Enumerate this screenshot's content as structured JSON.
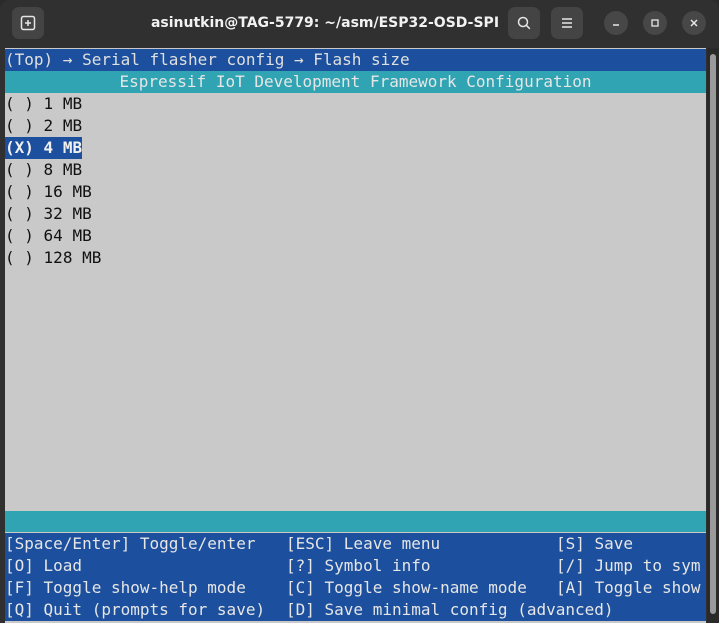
{
  "window": {
    "title": "asinutkin@TAG-5779: ~/asm/ESP32-OSD-SPI"
  },
  "menuconfig": {
    "breadcrumb": "(Top) → Serial flasher config → Flash size",
    "header": "Espressif IoT Development Framework Configuration",
    "options": [
      {
        "mark": "( )",
        "label": "1 MB"
      },
      {
        "mark": "( )",
        "label": "2 MB"
      },
      {
        "mark": "(X)",
        "label": "4 MB",
        "selected": true
      },
      {
        "mark": "( )",
        "label": "8 MB"
      },
      {
        "mark": "( )",
        "label": "16 MB"
      },
      {
        "mark": "( )",
        "label": "32 MB"
      },
      {
        "mark": "( )",
        "label": "64 MB"
      },
      {
        "mark": "( )",
        "label": "128 MB"
      }
    ],
    "footer": [
      [
        "[Space/Enter] Toggle/enter",
        "[ESC] Leave menu",
        "[S] Save"
      ],
      [
        "[O] Load",
        "[?] Symbol info",
        "[/] Jump to sym"
      ],
      [
        "[F] Toggle show-help mode",
        "[C] Toggle show-name mode",
        "[A] Toggle show"
      ],
      [
        "[Q] Quit (prompts for save)",
        "[D] Save minimal config (advanced)",
        ""
      ]
    ]
  },
  "colors": {
    "terminal_bg": "#c9c9c9",
    "blue_bar": "#1c4f9d",
    "teal_bar": "#30a4b2"
  }
}
